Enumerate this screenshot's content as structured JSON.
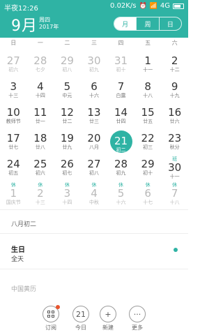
{
  "status": {
    "time": "半夜12:26",
    "speed": "0.02K/s",
    "network": "4G"
  },
  "header": {
    "month": "9月",
    "weekday": "周四",
    "year": "2017年"
  },
  "view_switch": [
    {
      "label": "月",
      "active": true
    },
    {
      "label": "周",
      "active": false
    },
    {
      "label": "日",
      "active": false
    }
  ],
  "weekdays": [
    "日",
    "一",
    "二",
    "三",
    "四",
    "五",
    "六"
  ],
  "weeks": [
    [
      {
        "d": "27",
        "l": "初六",
        "o": true
      },
      {
        "d": "28",
        "l": "七夕",
        "o": true
      },
      {
        "d": "29",
        "l": "初八",
        "o": true
      },
      {
        "d": "30",
        "l": "初九",
        "o": true
      },
      {
        "d": "31",
        "l": "初十",
        "o": true
      },
      {
        "d": "1",
        "l": "十一"
      },
      {
        "d": "2",
        "l": "十二"
      }
    ],
    [
      {
        "d": "3",
        "l": "十三"
      },
      {
        "d": "4",
        "l": "十四"
      },
      {
        "d": "5",
        "l": "中元"
      },
      {
        "d": "6",
        "l": "十六"
      },
      {
        "d": "7",
        "l": "白露"
      },
      {
        "d": "8",
        "l": "十八"
      },
      {
        "d": "9",
        "l": "十九"
      }
    ],
    [
      {
        "d": "10",
        "l": "教师节"
      },
      {
        "d": "11",
        "l": "廿一"
      },
      {
        "d": "12",
        "l": "廿二"
      },
      {
        "d": "13",
        "l": "廿三"
      },
      {
        "d": "14",
        "l": "廿四"
      },
      {
        "d": "15",
        "l": "廿五"
      },
      {
        "d": "16",
        "l": "廿六"
      }
    ],
    [
      {
        "d": "17",
        "l": "廿七"
      },
      {
        "d": "18",
        "l": "廿八"
      },
      {
        "d": "19",
        "l": "廿九"
      },
      {
        "d": "20",
        "l": "八月"
      },
      {
        "d": "21",
        "l": "初二",
        "sel": true
      },
      {
        "d": "22",
        "l": "初三"
      },
      {
        "d": "23",
        "l": "秋分"
      }
    ],
    [
      {
        "d": "24",
        "l": "初五"
      },
      {
        "d": "25",
        "l": "初六"
      },
      {
        "d": "26",
        "l": "初七"
      },
      {
        "d": "27",
        "l": "初八"
      },
      {
        "d": "28",
        "l": "初九"
      },
      {
        "d": "29",
        "l": "初十"
      },
      {
        "d": "30",
        "l": "十一",
        "r": "班"
      }
    ],
    [
      {
        "d": "1",
        "l": "国庆节",
        "o": true,
        "r": "休"
      },
      {
        "d": "2",
        "l": "十三",
        "o": true,
        "r": "休"
      },
      {
        "d": "3",
        "l": "十四",
        "o": true,
        "r": "休"
      },
      {
        "d": "4",
        "l": "中秋",
        "o": true,
        "r": "休"
      },
      {
        "d": "5",
        "l": "十六",
        "o": true,
        "r": "休"
      },
      {
        "d": "6",
        "l": "十七",
        "o": true,
        "r": "休"
      },
      {
        "d": "7",
        "l": "十八",
        "o": true,
        "r": "休"
      }
    ]
  ],
  "info": {
    "lunar_date": "八月初二",
    "event_title": "生日",
    "event_time": "全天",
    "almanac": "中国黄历"
  },
  "toolbar": {
    "subscribe": "订阅",
    "today_num": "21",
    "today": "今日",
    "new": "新建",
    "more": "更多",
    "new_glyph": "+",
    "more_glyph": "···"
  },
  "colors": {
    "accent": "#2fb3a4",
    "badge": "#e9552e"
  }
}
